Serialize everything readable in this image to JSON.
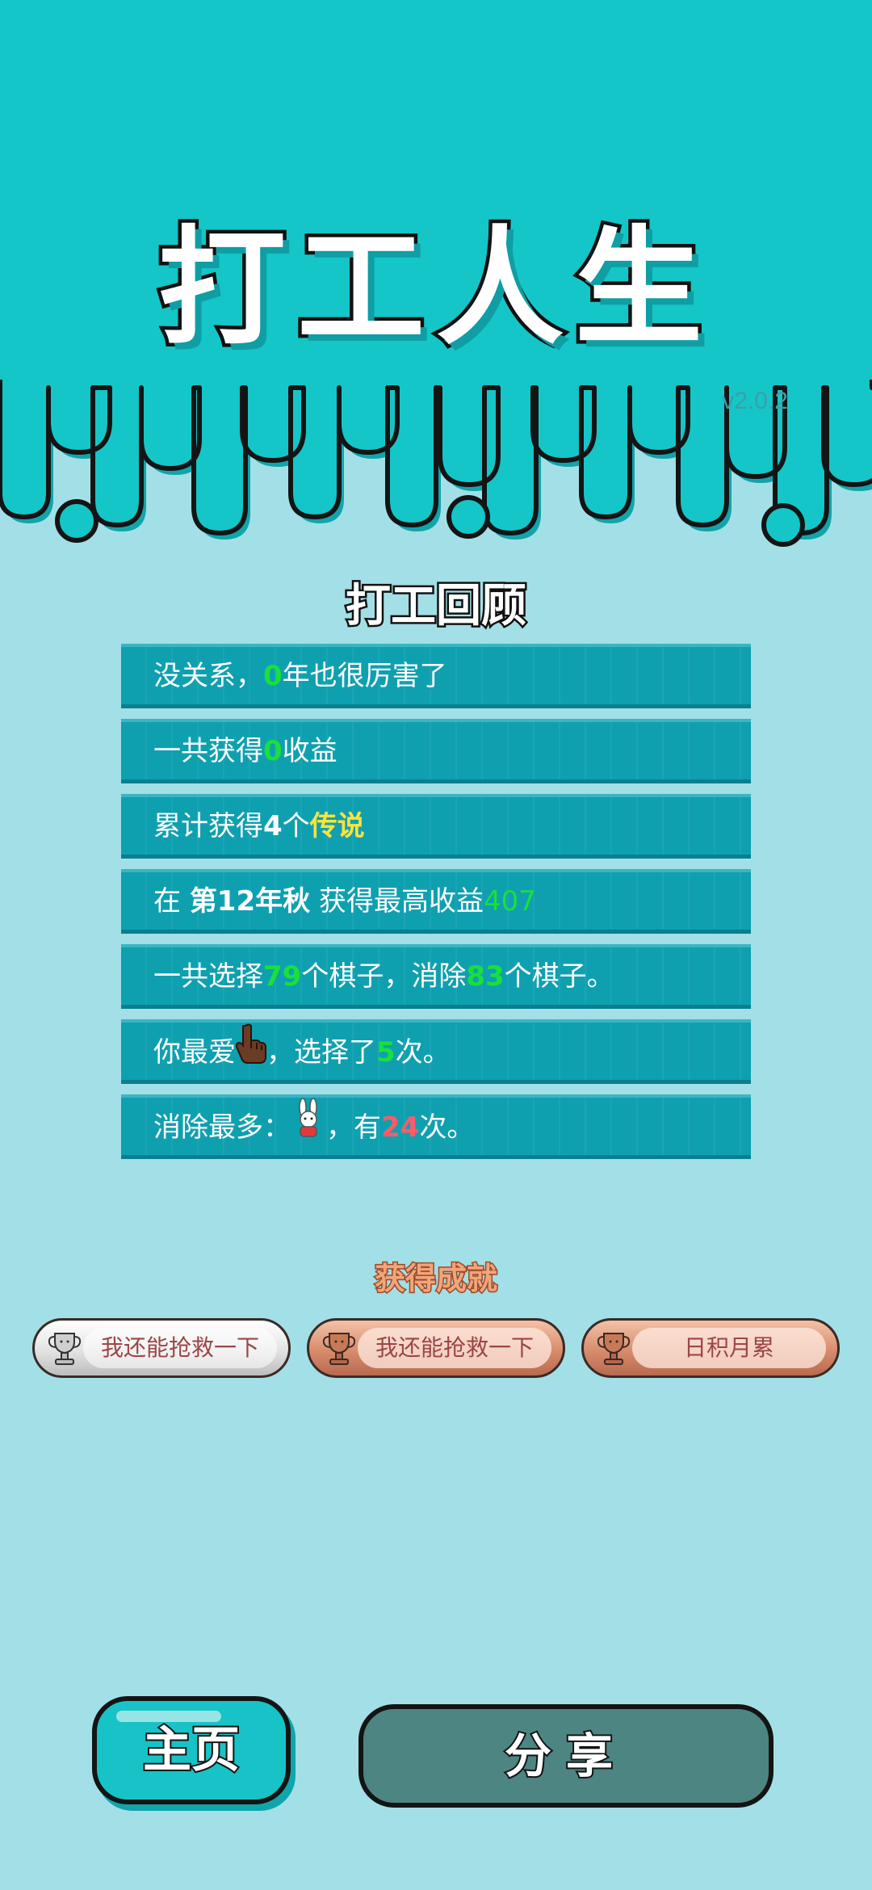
{
  "header": {
    "title": "打工人生",
    "version": "v2.0.2"
  },
  "review": {
    "title": "打工回顾",
    "rows": [
      {
        "pre": "没关系，",
        "num": "0",
        "post": "年也很厉害了"
      },
      {
        "pre": "一共获得",
        "num": "0",
        "post": "收益"
      },
      {
        "pre": "累计获得",
        "count": "4",
        "mid": "个",
        "highlight": "传说"
      },
      {
        "pre": "在 ",
        "bold": "第12年秋",
        "mid": " 获得最高收益",
        "num": "407"
      },
      {
        "pre": "一共选择",
        "num1": "79",
        "mid": "个棋子，消除",
        "num2": "83",
        "post": "个棋子。"
      },
      {
        "pre": "你最爱",
        "icon": "pointing-hand-icon",
        "mid": "，选择了",
        "num": "5",
        "post": "次。"
      },
      {
        "pre": "消除最多：",
        "icon": "rabbit-icon",
        "mid": "，有",
        "num": "24",
        "post": "次。"
      }
    ]
  },
  "achievements": {
    "title": "获得成就",
    "badges": [
      {
        "label": "我还能抢救一下",
        "tier": "silver",
        "icon": "trophy-icon"
      },
      {
        "label": "我还能抢救一下",
        "tier": "bronze",
        "icon": "trophy-icon"
      },
      {
        "label": "日积月累",
        "tier": "bronze",
        "icon": "trophy-icon"
      }
    ]
  },
  "buttons": {
    "home": "主页",
    "share": "分享"
  },
  "colors": {
    "header_bg": "#14c6c8",
    "page_bg": "#a3dfe6",
    "row_bg": "#0fa0b0",
    "highlight_green": "#19e03b",
    "highlight_yellow": "#ffe33a",
    "highlight_red": "#ff5a6a",
    "share_button": "#4d8582"
  }
}
